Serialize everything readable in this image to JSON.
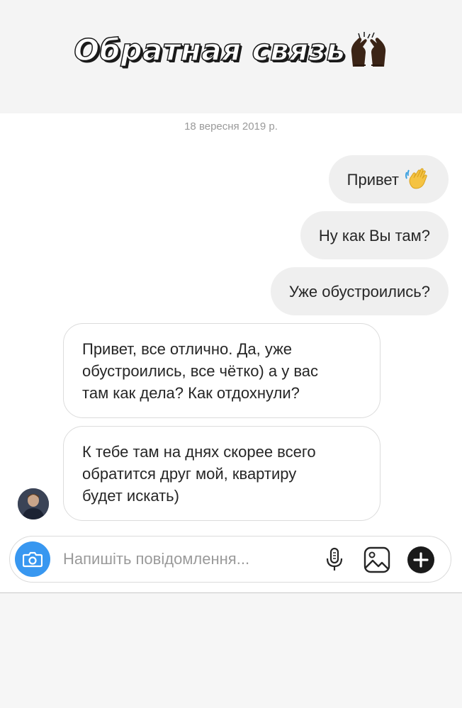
{
  "story": {
    "title": "Обратная связь",
    "title_emoji_icon": "raising-hands-icon"
  },
  "thread": {
    "date": "18 вересня 2019 р.",
    "messages": [
      {
        "direction": "outgoing",
        "text": "Привет",
        "emoji_icon": "waving-hand-icon"
      },
      {
        "direction": "outgoing",
        "text": "Ну как Вы там?"
      },
      {
        "direction": "outgoing",
        "text": "Уже обустроились?"
      },
      {
        "direction": "incoming",
        "lines": [
          "Привет, все отлично. Да, уже",
          "обустроились, все чётко) а у вас",
          "там как дела? Как отдохнули?"
        ]
      },
      {
        "direction": "incoming",
        "lines": [
          "К тебе там на днях скорее всего",
          "обратится друг мой, квартиру",
          "будет искать)"
        ]
      }
    ]
  },
  "composer": {
    "placeholder": "Напишіть повідомлення...",
    "camera_icon": "camera-icon",
    "mic_icon": "microphone-icon",
    "gallery_icon": "gallery-icon",
    "add_icon": "plus-circle-icon"
  },
  "colors": {
    "outgoing_bubble": "#efefef",
    "incoming_border": "#dcdcdc",
    "camera_button": "#3897f0",
    "text": "#262626",
    "muted": "#9a9a9a"
  }
}
